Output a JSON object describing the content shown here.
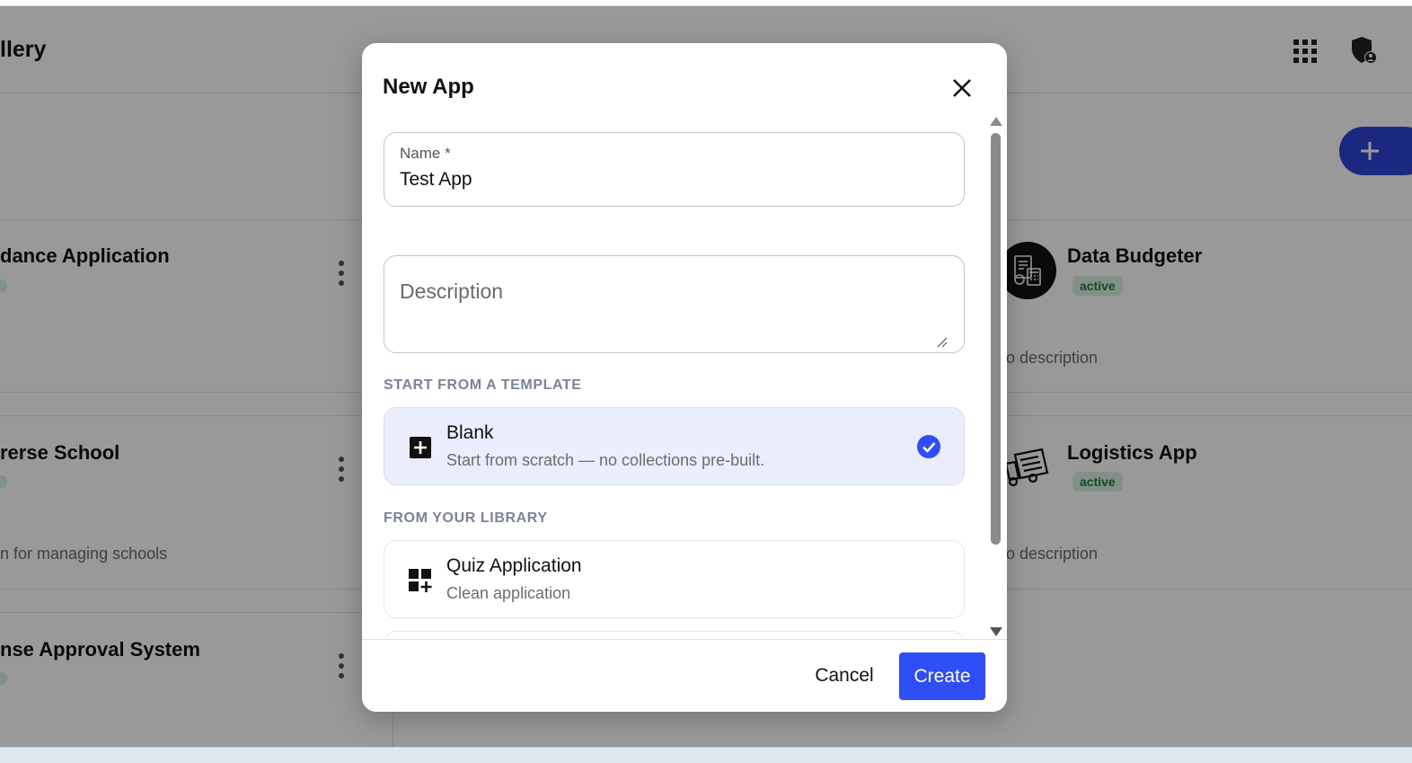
{
  "background": {
    "app_title": "llery",
    "cards": [
      {
        "title": "dance Application",
        "description": ""
      },
      {
        "title": "rerse School",
        "description": "n for managing schools"
      },
      {
        "title": "nse Approval System",
        "description": ""
      },
      {
        "title": "Data Budgeter",
        "status": "active",
        "description": "lo description"
      },
      {
        "title": "Logistics App",
        "status": "active",
        "description": "lo description"
      }
    ],
    "icons": {
      "apps": "grid-icon",
      "account": "shield-user-icon",
      "add": "plus-icon"
    }
  },
  "modal": {
    "title": "New App",
    "name_field": {
      "label": "Name *",
      "value": "Test App"
    },
    "description_field": {
      "placeholder": "Description",
      "value": ""
    },
    "template_section_label": "START FROM A TEMPLATE",
    "templates": [
      {
        "title": "Blank",
        "subtitle": "Start from scratch — no collections pre-built.",
        "selected": true,
        "icon": "plus-square-icon"
      }
    ],
    "library_section_label": "FROM YOUR LIBRARY",
    "library": [
      {
        "title": "Quiz Application",
        "subtitle": "Clean application",
        "icon": "widgets-add-icon"
      }
    ],
    "footer": {
      "cancel_label": "Cancel",
      "create_label": "Create"
    }
  },
  "colors": {
    "primary": "#2f4ef5",
    "fab": "#2d44d4",
    "selected_bg": "#eaedfb",
    "badge_bg": "#d9f2e2",
    "badge_text": "#1e7a45",
    "overlay": "rgba(0,0,0,0.40)"
  }
}
